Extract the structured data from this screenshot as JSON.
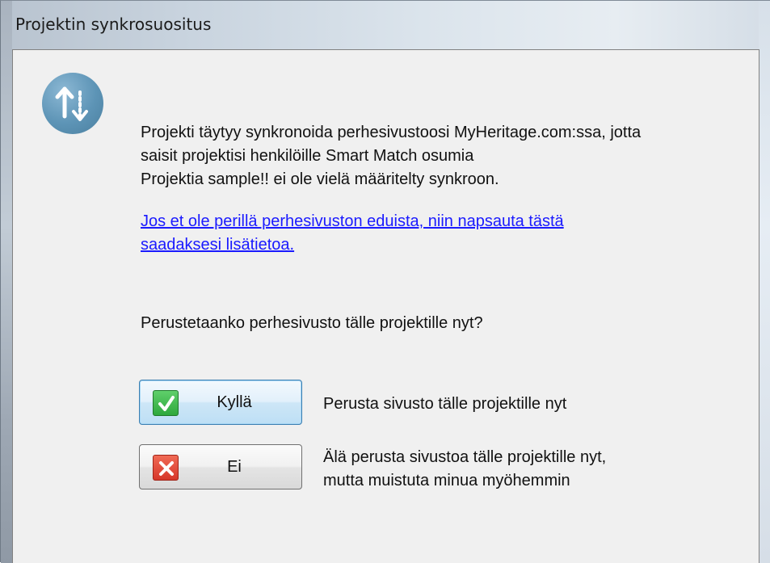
{
  "window": {
    "title": "Projektin synkrosuositus"
  },
  "icon": {
    "name": "sync-arrows-icon"
  },
  "message": {
    "line1": "Projekti täytyy synkronoida perhesivustoosi MyHeritage.com:ssa, jotta",
    "line2": "saisit projektisi henkilöille Smart Match osumia",
    "line3": "Projektia sample!! ei ole vielä määritelty synkroon."
  },
  "link": {
    "line1": "Jos et ole perillä perhesivuston eduista, niin napsauta tästä",
    "line2": "saadaksesi lisätietoa."
  },
  "question": "Perustetaanko perhesivusto tälle projektille nyt?",
  "buttons": {
    "yes": {
      "label": "Kyllä",
      "icon": "checkmark-icon",
      "description": "Perusta sivusto tälle projektille nyt"
    },
    "no": {
      "label": "Ei",
      "icon": "x-icon",
      "description_line1": "Älä perusta sivustoa tälle projektille nyt,",
      "description_line2": "mutta muistuta minua myöhemmin"
    }
  },
  "colors": {
    "link": "#1a1aff",
    "client_background": "#f0f0f0",
    "yes_icon": "#2ea83d",
    "no_icon": "#d6372a",
    "sync_icon": "#5d94b6"
  }
}
